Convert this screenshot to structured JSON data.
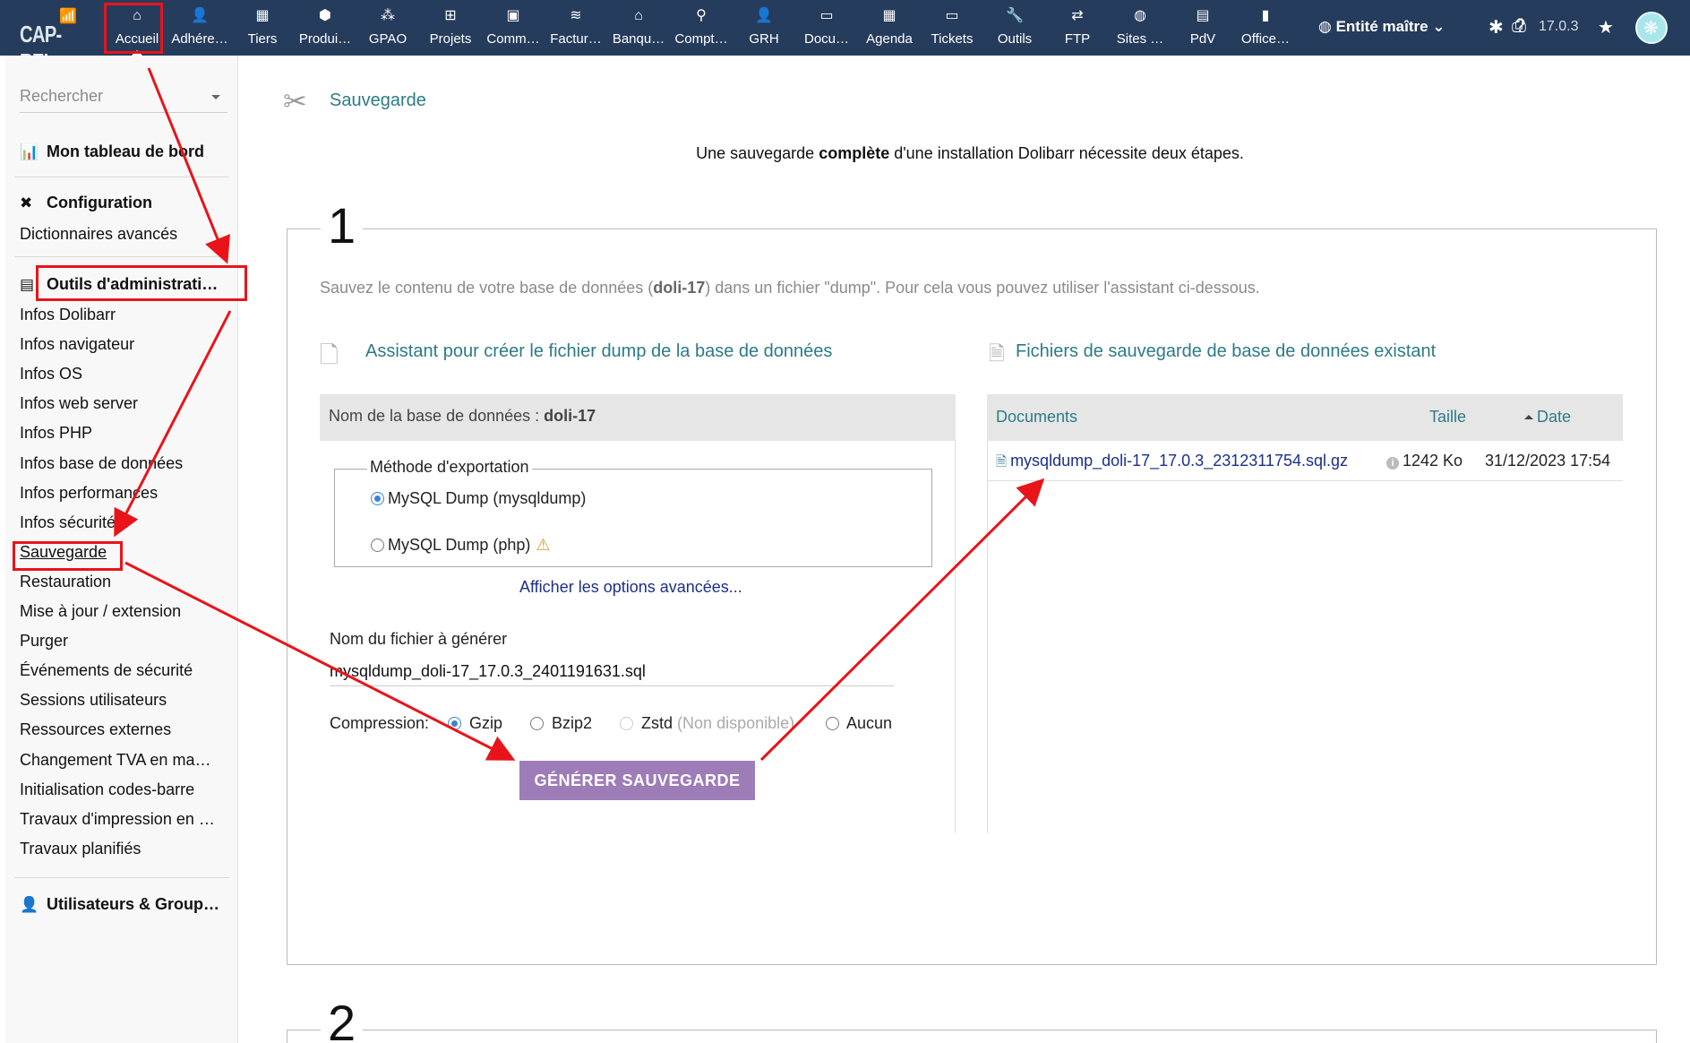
{
  "topbar": {
    "logo_text": "CAP-REL",
    "menu": [
      {
        "label": "Accueil",
        "icon": "home-icon",
        "glyph": "⌂"
      },
      {
        "label": "Adhére…",
        "icon": "member-icon",
        "glyph": "👤"
      },
      {
        "label": "Tiers",
        "icon": "building-icon",
        "glyph": "▦"
      },
      {
        "label": "Produi…",
        "icon": "cube-icon",
        "glyph": "⬢"
      },
      {
        "label": "GPAO",
        "icon": "cubes-icon",
        "glyph": "⁂"
      },
      {
        "label": "Projets",
        "icon": "sitemap-icon",
        "glyph": "⊞"
      },
      {
        "label": "Comm…",
        "icon": "suitcase-icon",
        "glyph": "▣"
      },
      {
        "label": "Factur…",
        "icon": "coins-icon",
        "glyph": "≋"
      },
      {
        "label": "Banqu…",
        "icon": "bank-icon",
        "glyph": "⌂"
      },
      {
        "label": "Compt…",
        "icon": "search-dollar-icon",
        "glyph": "⚲"
      },
      {
        "label": "GRH",
        "icon": "user-tie-icon",
        "glyph": "👤"
      },
      {
        "label": "Docu…",
        "icon": "folder-open-icon",
        "glyph": "▭"
      },
      {
        "label": "Agenda",
        "icon": "calendar-icon",
        "glyph": "▦"
      },
      {
        "label": "Tickets",
        "icon": "ticket-icon",
        "glyph": "▭"
      },
      {
        "label": "Outils",
        "icon": "wrench-icon",
        "glyph": "🔧"
      },
      {
        "label": "FTP",
        "icon": "exchange-icon",
        "glyph": "⇄"
      },
      {
        "label": "Sites …",
        "icon": "globe-icon",
        "glyph": "◍"
      },
      {
        "label": "PdV",
        "icon": "cash-register-icon",
        "glyph": "▤"
      },
      {
        "label": "Office…",
        "icon": "office-icon",
        "glyph": "▮"
      }
    ],
    "entity": "Entité maître",
    "version": "17.0.3",
    "colors": {
      "bar": "#263c5c",
      "accent": "#2d7a86",
      "button": "#9e7cb8",
      "annotation": "#e8141a"
    }
  },
  "sidebar": {
    "search_placeholder": "Rechercher",
    "dashboard": "Mon tableau de bord",
    "config_head": "Configuration",
    "config_items": [
      "Dictionnaires avancés"
    ],
    "admin_head": "Outils d'administrati…",
    "admin_items": [
      "Infos Dolibarr",
      "Infos navigateur",
      "Infos OS",
      "Infos web server",
      "Infos PHP",
      "Infos base de données",
      "Infos performances",
      "Infos sécurité",
      "Sauvegarde",
      "Restauration",
      "Mise à jour / extension",
      "Purger",
      "Événements de sécurité",
      "Sessions utilisateurs",
      "Ressources externes",
      "Changement TVA en ma…",
      "Initialisation codes-barre",
      "Travaux d'impression en …",
      "Travaux planifiés"
    ],
    "users_head": "Utilisateurs & Group…"
  },
  "main": {
    "title": "Sauvegarde",
    "intro_pre": "Une sauvegarde ",
    "intro_bold": "complète",
    "intro_post": " d'une installation Dolibarr nécessite deux étapes.",
    "step1": "1",
    "step2": "2",
    "step1_desc_pre": "Sauvez le contenu de votre base de données (",
    "step1_desc_db": "doli-17",
    "step1_desc_post": ") dans un fichier \"dump\". Pour cela vous pouvez utiliser l'assistant ci-dessous.",
    "wizard_title": "Assistant pour créer le fichier dump de la base de données",
    "existing_title": "Fichiers de sauvegarde de base de données existant",
    "db_name_label": "Nom de la base de données : ",
    "db_name": "doli-17",
    "export_method_legend": "Méthode d'exportation",
    "method_options": [
      "MySQL Dump (mysqldump)",
      "MySQL Dump (php)"
    ],
    "advanced_link": "Afficher les options avancées...",
    "filename_label": "Nom du fichier à générer",
    "filename_value": "mysqldump_doli-17_17.0.3_2401191631.sql",
    "compression_label": "Compression:",
    "compression_options": [
      "Gzip",
      "Bzip2",
      "Zstd",
      "Aucun"
    ],
    "compression_unavailable": "(Non disponible)",
    "generate_button": "GÉNÉRER SAUVEGARDE",
    "files_table": {
      "headers": [
        "Documents",
        "Taille",
        "Date"
      ],
      "rows": [
        {
          "name": "mysqldump_doli-17_17.0.3_2312311754.sql.gz",
          "size": "1242 Ko",
          "date": "31/12/2023 17:54"
        }
      ]
    }
  }
}
